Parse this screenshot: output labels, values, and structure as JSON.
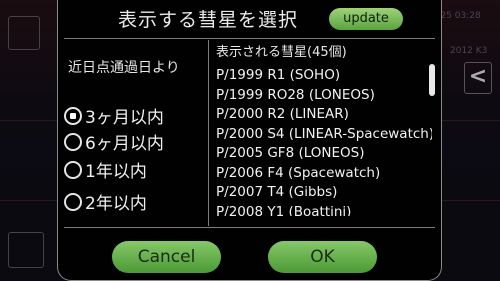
{
  "background": {
    "timestamp": "2017/12/25 03:28",
    "label_k3": "2012 K3",
    "side_arrow": "<"
  },
  "dialog": {
    "title": "表示する彗星を選択",
    "update_label": "update",
    "period_label": "近日点通過日より",
    "options": [
      {
        "label": "3ヶ月以内",
        "checked": true
      },
      {
        "label": "6ヶ月以内",
        "checked": false
      },
      {
        "label": "1年以内",
        "checked": false
      },
      {
        "label": "2年以内",
        "checked": false
      }
    ],
    "list_header": "表示される彗星(45個)",
    "comets": [
      "P/1999 R1 (SOHO)",
      "P/1999 RO28 (LONEOS)",
      "P/2000 R2 (LINEAR)",
      "P/2000 S4 (LINEAR-Spacewatch)",
      "P/2005 GF8 (LONEOS)",
      "P/2006 F4 (Spacewatch)",
      "P/2007 T4 (Gibbs)",
      "P/2008 Y1 (Boattini)"
    ],
    "cancel_label": "Cancel",
    "ok_label": "OK"
  },
  "colors": {
    "button_green": "#6cb34f",
    "dialog_bg": "#010101"
  }
}
